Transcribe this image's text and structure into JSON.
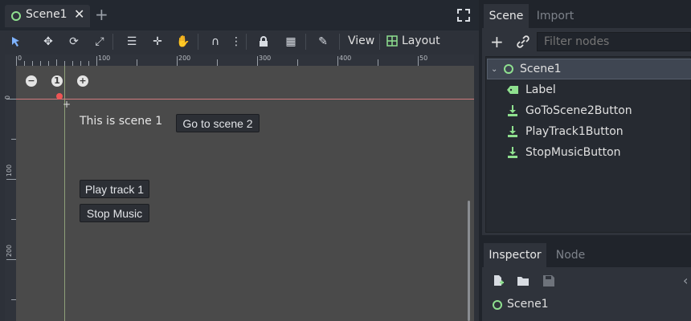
{
  "editor": {
    "scene_tab_label": "Scene1",
    "add_tab_icon": "plus-icon",
    "fullscreen_icon": "fullscreen-icon",
    "toolbar": {
      "view_label": "View",
      "layout_label": "Layout"
    },
    "ruler": {
      "top_labels": [
        "0",
        "100",
        "200",
        "300",
        "400",
        "50"
      ],
      "left_labels": [
        "0",
        "100",
        "200"
      ]
    },
    "zoom": {
      "minus": "−",
      "reset": "1",
      "plus": "+"
    },
    "scene": {
      "label_text": "This is scene 1",
      "goto_button": "Go to scene 2",
      "play_button": "Play track 1",
      "stop_button": "Stop Music"
    }
  },
  "scene_dock": {
    "tabs": [
      "Scene",
      "Import"
    ],
    "filter_placeholder": "Filter nodes",
    "tree": [
      {
        "name": "Scene1",
        "icon": "control-node-icon",
        "depth": 0,
        "selected": true
      },
      {
        "name": "Label",
        "icon": "label-node-icon",
        "depth": 1
      },
      {
        "name": "GoToScene2Button",
        "icon": "button-node-icon",
        "depth": 1
      },
      {
        "name": "PlayTrack1Button",
        "icon": "button-node-icon",
        "depth": 1
      },
      {
        "name": "StopMusicButton",
        "icon": "button-node-icon",
        "depth": 1
      }
    ]
  },
  "inspector_dock": {
    "tabs": [
      "Inspector",
      "Node"
    ],
    "object_name": "Scene1"
  },
  "colors": {
    "accent": "#8fe08f",
    "canvas": "#4a4a4a",
    "selection": "#3f4652"
  }
}
